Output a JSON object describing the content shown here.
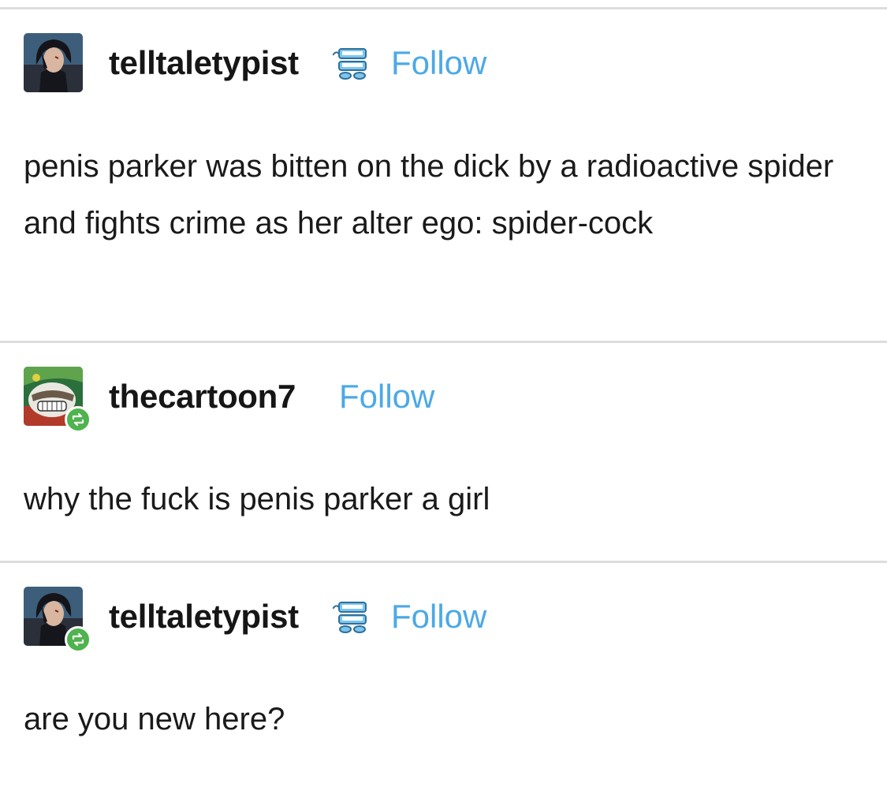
{
  "posts": [
    {
      "username": "telltaletypist",
      "follow_label": "Follow",
      "avatar_icon": "user-avatar-dark-hair",
      "has_badge": true,
      "reblogged": false,
      "text": "penis parker was bitten on the dick by a radioactive spider and fights crime as her alter ego: spider-cock"
    },
    {
      "username": "thecartoon7",
      "follow_label": "Follow",
      "avatar_icon": "user-avatar-cartoon",
      "has_badge": false,
      "reblogged": true,
      "text": "why the fuck is penis parker a girl"
    },
    {
      "username": "telltaletypist",
      "follow_label": "Follow",
      "avatar_icon": "user-avatar-dark-hair",
      "has_badge": true,
      "reblogged": true,
      "text": "are you new here?"
    }
  ],
  "colors": {
    "follow": "#4ca9e6",
    "reblog_badge": "#4fb34f",
    "divider": "#dddddd"
  }
}
